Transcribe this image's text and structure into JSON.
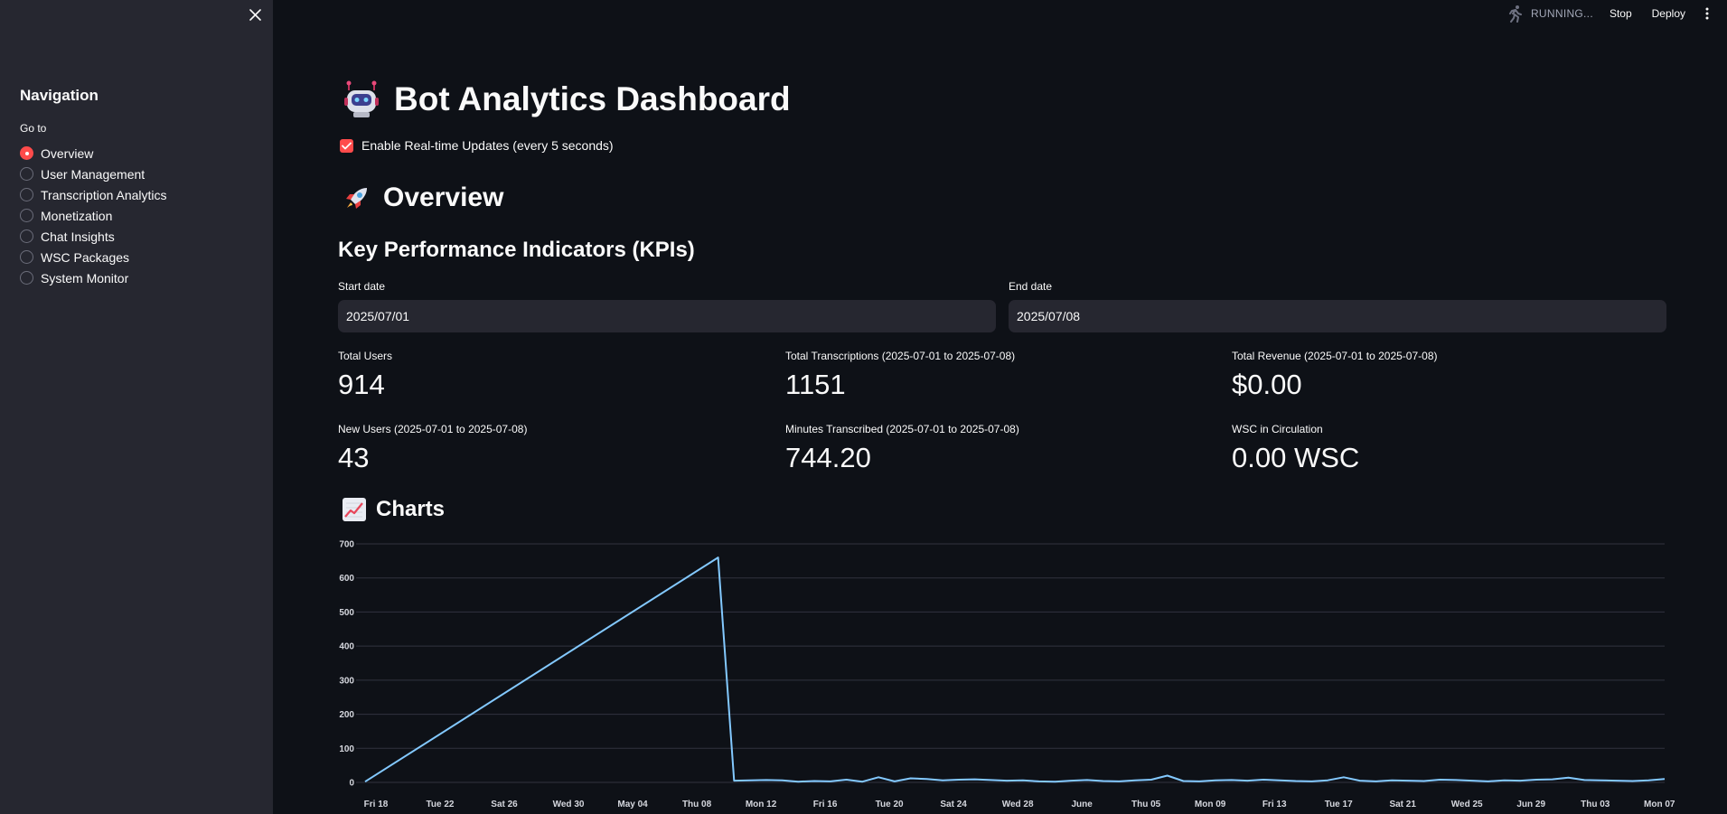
{
  "sidebar": {
    "title": "Navigation",
    "radio_label": "Go to",
    "items": [
      {
        "label": "Overview",
        "selected": true
      },
      {
        "label": "User Management",
        "selected": false
      },
      {
        "label": "Transcription Analytics",
        "selected": false
      },
      {
        "label": "Monetization",
        "selected": false
      },
      {
        "label": "Chat Insights",
        "selected": false
      },
      {
        "label": "WSC Packages",
        "selected": false
      },
      {
        "label": "System Monitor",
        "selected": false
      }
    ]
  },
  "header": {
    "status": "RUNNING...",
    "stop_label": "Stop",
    "deploy_label": "Deploy"
  },
  "page": {
    "title": "Bot Analytics Dashboard",
    "realtime_label": "Enable Real-time Updates (every 5 seconds)",
    "realtime_checked": true,
    "overview_title": "Overview",
    "kpi_heading": "Key Performance Indicators (KPIs)",
    "start_date_label": "Start date",
    "start_date_value": "2025/07/01",
    "end_date_label": "End date",
    "end_date_value": "2025/07/08",
    "charts_title": "Charts"
  },
  "metrics": [
    {
      "label": "Total Users",
      "value": "914"
    },
    {
      "label": "Total Transcriptions (2025-07-01 to 2025-07-08)",
      "value": "1151"
    },
    {
      "label": "Total Revenue (2025-07-01 to 2025-07-08)",
      "value": "$0.00"
    },
    {
      "label": "New Users (2025-07-01 to 2025-07-08)",
      "value": "43"
    },
    {
      "label": "Minutes Transcribed (2025-07-01 to 2025-07-08)",
      "value": "744.20"
    },
    {
      "label": "WSC in Circulation",
      "value": "0.00 WSC"
    }
  ],
  "colors": {
    "accent": "#ff4b4b",
    "line": "#83c9ff",
    "background": "#0e1117",
    "sidebar": "#262730"
  },
  "chart_data": {
    "type": "line",
    "title": "",
    "xlabel": "",
    "ylabel": "",
    "ylim": [
      0,
      700
    ],
    "yticks": [
      0,
      100,
      200,
      300,
      400,
      500,
      600,
      700
    ],
    "x_tick_labels": [
      "Fri 18",
      "Tue 22",
      "Sat 26",
      "Wed 30",
      "May 04",
      "Thu 08",
      "Mon 12",
      "Fri 16",
      "Tue 20",
      "Sat 24",
      "Wed 28",
      "June",
      "Thu 05",
      "Mon 09",
      "Fri 13",
      "Tue 17",
      "Sat 21",
      "Wed 25",
      "Jun 29",
      "Thu 03",
      "Mon 07"
    ],
    "x": [
      "2025-04-18",
      "2025-05-10",
      "2025-05-11",
      "2025-05-12",
      "2025-05-13",
      "2025-05-14",
      "2025-05-15",
      "2025-05-16",
      "2025-05-17",
      "2025-05-18",
      "2025-05-19",
      "2025-05-20",
      "2025-05-21",
      "2025-05-22",
      "2025-05-23",
      "2025-05-24",
      "2025-05-25",
      "2025-05-26",
      "2025-05-27",
      "2025-05-28",
      "2025-05-29",
      "2025-05-30",
      "2025-05-31",
      "2025-06-01",
      "2025-06-02",
      "2025-06-03",
      "2025-06-04",
      "2025-06-05",
      "2025-06-06",
      "2025-06-07",
      "2025-06-08",
      "2025-06-09",
      "2025-06-10",
      "2025-06-11",
      "2025-06-12",
      "2025-06-13",
      "2025-06-14",
      "2025-06-15",
      "2025-06-16",
      "2025-06-17",
      "2025-06-18",
      "2025-06-19",
      "2025-06-20",
      "2025-06-21",
      "2025-06-22",
      "2025-06-23",
      "2025-06-24",
      "2025-06-25",
      "2025-06-26",
      "2025-06-27",
      "2025-06-28",
      "2025-06-29",
      "2025-06-30",
      "2025-07-01",
      "2025-07-02",
      "2025-07-03",
      "2025-07-04",
      "2025-07-05",
      "2025-07-06",
      "2025-07-07",
      "2025-07-08"
    ],
    "series": [
      {
        "values": [
          2,
          660,
          5,
          6,
          7,
          6,
          2,
          4,
          3,
          8,
          2,
          15,
          3,
          12,
          10,
          6,
          8,
          9,
          7,
          5,
          6,
          3,
          2,
          5,
          7,
          4,
          3,
          6,
          8,
          20,
          4,
          3,
          6,
          7,
          5,
          8,
          6,
          4,
          3,
          6,
          15,
          5,
          3,
          6,
          5,
          4,
          8,
          7,
          5,
          3,
          6,
          5,
          8,
          9,
          14,
          7,
          6,
          5,
          4,
          6,
          10
        ]
      }
    ]
  }
}
